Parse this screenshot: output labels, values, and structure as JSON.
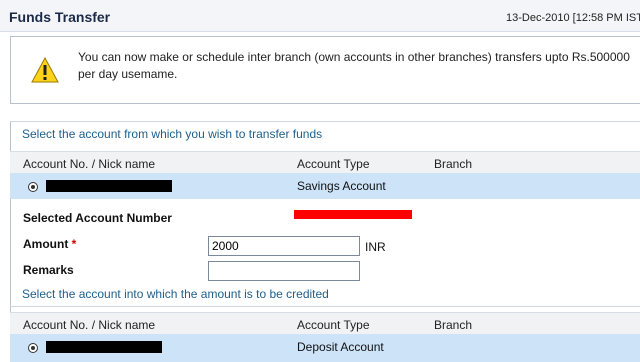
{
  "header": {
    "title": "Funds Transfer",
    "datetime": "13-Dec-2010 [12:58 PM IST"
  },
  "notice": {
    "icon": "warning-icon",
    "message": "You can now make or schedule inter branch (own accounts in other branches) transfers upto Rs.500000 per day usemame."
  },
  "from_section": {
    "title": "Select the account from which you wish to transfer funds",
    "columns": [
      "Account No. / Nick name",
      "Account Type",
      "Branch"
    ],
    "rows": [
      {
        "account_type": "Savings Account",
        "selected": true
      }
    ]
  },
  "form": {
    "selected_account_label": "Selected Account Number",
    "amount_label": "Amount",
    "amount_required": "*",
    "amount_value": "2000",
    "amount_unit": "INR",
    "remarks_label": "Remarks",
    "remarks_value": ""
  },
  "to_section": {
    "title": "Select the account into which the amount is to be credited",
    "columns": [
      "Account No. / Nick name",
      "Account Type",
      "Branch"
    ],
    "rows": [
      {
        "account_type": "Deposit Account",
        "selected": true
      }
    ]
  }
}
